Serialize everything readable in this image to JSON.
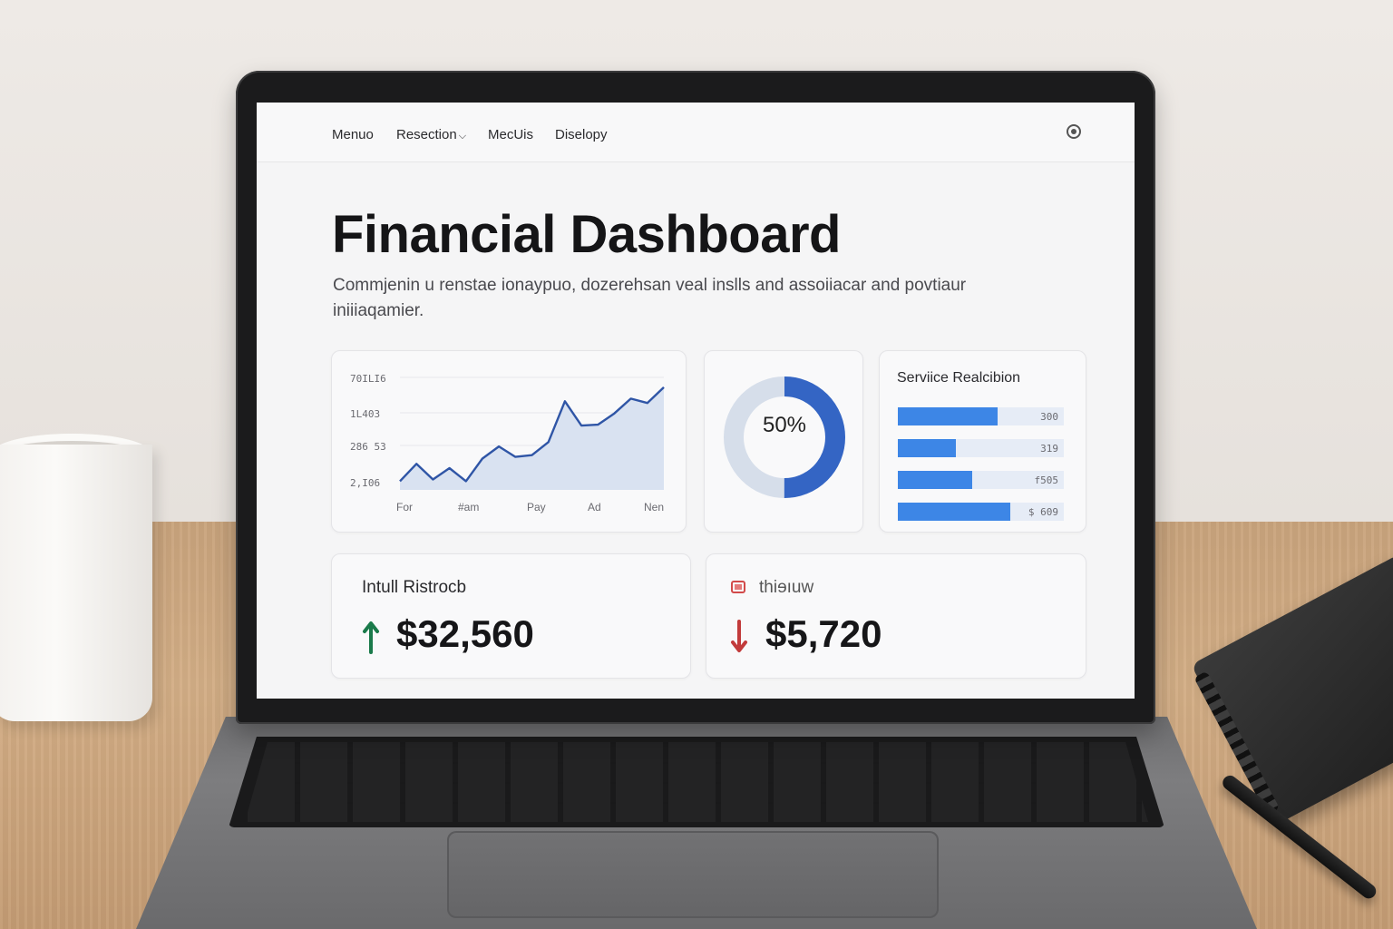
{
  "nav": {
    "items": [
      "Menuo",
      "Resection",
      "MecUis",
      "Diselopy"
    ],
    "dropdown_index": 1,
    "avatar_icon": "user-avatar-icon"
  },
  "hero": {
    "title": "Financial Dashboard",
    "subtitle": "Commjenin u renstae ionaypuo, dozerehsan veal inslls and assoiiacar and povtiaur iniiiaqamier."
  },
  "colors": {
    "accent": "#2f55a6",
    "area_fill": "#d9e2f1",
    "bar": "#3d86e6",
    "bar_track": "#e6ecf6",
    "donut": "#3465c4",
    "donut_track": "#d6deea",
    "up": "#1a7a4a",
    "down": "#c23b3b"
  },
  "chart_data": [
    {
      "type": "area",
      "y_tick_labels": [
        "70ILI6",
        "1L403",
        "286 53",
        "2,I06"
      ],
      "x_tick_labels": [
        "For",
        "#am",
        "Pay",
        "Ad",
        "Nen"
      ],
      "series": [
        {
          "values": [
            1,
            3,
            1.2,
            2.5,
            1,
            3.6,
            5,
            3.8,
            4,
            5.5,
            10.2,
            7.4,
            7.5,
            8.8,
            10.5,
            10,
            11.8
          ]
        }
      ]
    },
    {
      "type": "pie",
      "label": "50%",
      "values": [
        50,
        50
      ]
    },
    {
      "type": "bar",
      "title": "Serviice Realcibion",
      "orientation": "horizontal",
      "values": [
        0.6,
        0.35,
        0.45,
        0.68
      ],
      "value_labels": [
        "300",
        "319",
        "f505",
        "$ 609"
      ]
    }
  ],
  "stats": [
    {
      "label": "Intull Ristrocb",
      "value": "$32,560",
      "direction": "up",
      "icon": "arrow-up-icon"
    },
    {
      "label": "thiɘıuw",
      "value": "$5,720",
      "direction": "down",
      "icon": "arrow-down-icon"
    }
  ]
}
